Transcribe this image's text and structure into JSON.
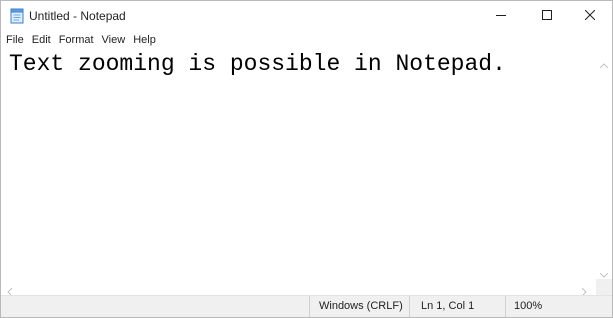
{
  "window": {
    "title": "Untitled - Notepad"
  },
  "icons": {
    "app": "notepad-icon",
    "minimize": "minimize-icon",
    "maximize": "maximize-icon",
    "close": "close-icon"
  },
  "menu": {
    "items": [
      "File",
      "Edit",
      "Format",
      "View",
      "Help"
    ]
  },
  "editor": {
    "content": "Text zooming is possible in Notepad."
  },
  "statusbar": {
    "line_ending": "Windows (CRLF)",
    "position": "Ln 1, Col 1",
    "zoom": "100%"
  }
}
